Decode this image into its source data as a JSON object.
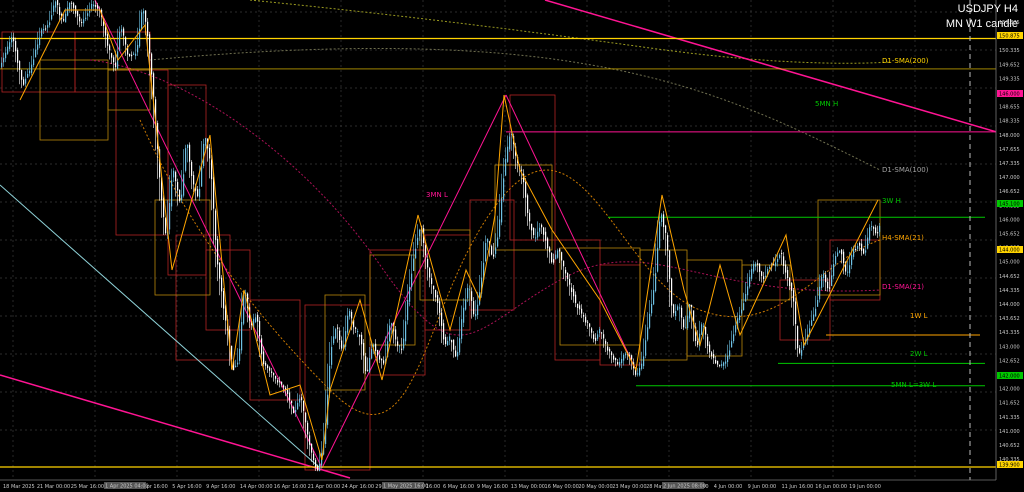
{
  "symbol_title": "USDJPY H4",
  "subtitle": "MN W1 candle",
  "chart_data": {
    "type": "candlestick",
    "title": "USDJPY H4",
    "ylim": [
      140.0,
      151.4
    ],
    "price_ticks": [
      "150.875",
      "150.652",
      "150.335",
      "149.652",
      "149.335",
      "149.000",
      "148.655",
      "148.335",
      "148.000",
      "147.655",
      "147.335",
      "147.000",
      "146.652",
      "146.335",
      "146.000",
      "145.652",
      "145.335",
      "145.000",
      "144.652",
      "144.335",
      "144.000",
      "143.652",
      "143.335",
      "143.000",
      "142.652",
      "142.335",
      "142.000",
      "141.652",
      "141.335",
      "141.000",
      "140.652",
      "140.335"
    ],
    "time_labels": [
      "18 Mar 2025",
      "21 Mar 00:00",
      "25 Mar 16:00",
      "31 Mar 00:00",
      "2 Apr 16:00",
      "5 Apr 16:00",
      "9 Apr 16:00",
      "14 Apr 00:00",
      "16 Apr 16:00",
      "21 Apr 00:00",
      "24 Apr 16:00",
      "29 Apr 00:00",
      "2 May 16:00",
      "6 May 16:00",
      "9 May 16:00",
      "13 May 00:00",
      "16 May 00:00",
      "20 May 00:00",
      "23 May 00:00",
      "28 May 16:00",
      "2 Jun 00:00",
      "4 Jun 00:00",
      "9 Jun 00:00",
      "11 Jun 16:00",
      "16 Jun 00:00",
      "19 Jun 00:00"
    ],
    "highlight_labels": [
      {
        "text": "1 Apr 2025 04:00",
        "value": "highlight-date-1"
      },
      {
        "text": "1 May 2025 16:00",
        "value": "highlight-date-2"
      },
      {
        "text": "2 Jun 2025 08:00",
        "value": "highlight-date-3"
      }
    ],
    "price_path": [
      [
        0,
        149.9
      ],
      [
        12,
        150.6
      ],
      [
        22,
        149.4
      ],
      [
        30,
        149.8
      ],
      [
        40,
        150.7
      ],
      [
        48,
        150.9
      ],
      [
        55,
        151.5
      ],
      [
        62,
        150.9
      ],
      [
        70,
        151.5
      ],
      [
        80,
        150.9
      ],
      [
        92,
        151.4
      ],
      [
        100,
        151.2
      ],
      [
        108,
        150.3
      ],
      [
        115,
        149.8
      ],
      [
        120,
        150.9
      ],
      [
        128,
        150.1
      ],
      [
        136,
        150.2
      ],
      [
        142,
        151.4
      ],
      [
        148,
        150.5
      ],
      [
        154,
        148.8
      ],
      [
        160,
        146.8
      ],
      [
        166,
        145.5
      ],
      [
        172,
        147.4
      ],
      [
        180,
        146.4
      ],
      [
        186,
        148.1
      ],
      [
        192,
        147.0
      ],
      [
        198,
        146.6
      ],
      [
        204,
        148.2
      ],
      [
        210,
        147.5
      ],
      [
        216,
        145.2
      ],
      [
        222,
        144.1
      ],
      [
        228,
        143.2
      ],
      [
        232,
        142.4
      ],
      [
        238,
        142.6
      ],
      [
        244,
        144.5
      ],
      [
        250,
        143.4
      ],
      [
        256,
        143.8
      ],
      [
        262,
        142.6
      ],
      [
        270,
        142.3
      ],
      [
        278,
        142.1
      ],
      [
        286,
        141.9
      ],
      [
        294,
        141.3
      ],
      [
        300,
        141.8
      ],
      [
        306,
        140.9
      ],
      [
        312,
        140.2
      ],
      [
        318,
        139.9
      ],
      [
        324,
        140.7
      ],
      [
        330,
        142.9
      ],
      [
        336,
        143.5
      ],
      [
        342,
        142.8
      ],
      [
        348,
        143.9
      ],
      [
        354,
        143.4
      ],
      [
        360,
        143.2
      ],
      [
        366,
        142.2
      ],
      [
        372,
        143.1
      ],
      [
        378,
        142.7
      ],
      [
        384,
        142.5
      ],
      [
        390,
        143.7
      ],
      [
        396,
        143.0
      ],
      [
        402,
        142.9
      ],
      [
        408,
        144.3
      ],
      [
        414,
        145.3
      ],
      [
        420,
        146.0
      ],
      [
        426,
        145.0
      ],
      [
        432,
        144.4
      ],
      [
        438,
        144.0
      ],
      [
        444,
        143.0
      ],
      [
        450,
        143.2
      ],
      [
        456,
        142.6
      ],
      [
        462,
        143.8
      ],
      [
        468,
        144.5
      ],
      [
        474,
        143.6
      ],
      [
        480,
        144.4
      ],
      [
        486,
        145.7
      ],
      [
        492,
        145.1
      ],
      [
        498,
        145.8
      ],
      [
        504,
        147.4
      ],
      [
        510,
        148.3
      ],
      [
        516,
        147.5
      ],
      [
        522,
        147.2
      ],
      [
        528,
        146.1
      ],
      [
        534,
        145.6
      ],
      [
        540,
        146.0
      ],
      [
        546,
        145.5
      ],
      [
        552,
        145.0
      ],
      [
        558,
        145.4
      ],
      [
        564,
        144.8
      ],
      [
        570,
        144.4
      ],
      [
        576,
        144.0
      ],
      [
        582,
        143.7
      ],
      [
        588,
        143.5
      ],
      [
        594,
        143.1
      ],
      [
        600,
        143.4
      ],
      [
        606,
        142.9
      ],
      [
        612,
        142.7
      ],
      [
        618,
        142.5
      ],
      [
        624,
        142.8
      ],
      [
        630,
        142.7
      ],
      [
        636,
        142.2
      ],
      [
        642,
        142.6
      ],
      [
        648,
        143.6
      ],
      [
        654,
        144.5
      ],
      [
        660,
        146.3
      ],
      [
        666,
        145.6
      ],
      [
        672,
        143.7
      ],
      [
        678,
        144.0
      ],
      [
        684,
        143.3
      ],
      [
        690,
        144.1
      ],
      [
        696,
        142.9
      ],
      [
        702,
        143.6
      ],
      [
        708,
        142.9
      ],
      [
        714,
        142.6
      ],
      [
        720,
        142.5
      ],
      [
        726,
        142.6
      ],
      [
        732,
        143.2
      ],
      [
        738,
        143.7
      ],
      [
        744,
        144.1
      ],
      [
        750,
        144.8
      ],
      [
        756,
        145.1
      ],
      [
        762,
        144.6
      ],
      [
        768,
        144.9
      ],
      [
        774,
        145.0
      ],
      [
        780,
        145.3
      ],
      [
        786,
        144.7
      ],
      [
        792,
        144.3
      ],
      [
        798,
        142.7
      ],
      [
        804,
        143.1
      ],
      [
        810,
        143.5
      ],
      [
        816,
        144.0
      ],
      [
        822,
        144.8
      ],
      [
        828,
        144.3
      ],
      [
        834,
        145.1
      ],
      [
        840,
        145.4
      ],
      [
        846,
        144.7
      ],
      [
        852,
        145.3
      ],
      [
        858,
        145.5
      ],
      [
        864,
        145.2
      ],
      [
        870,
        146.0
      ],
      [
        876,
        145.7
      ],
      [
        880,
        146.0
      ]
    ],
    "horizontal_levels": [
      {
        "name": "top-line-yellow",
        "price": 150.55,
        "color": "#ffd400"
      },
      {
        "name": "level-149-8",
        "price": 149.8,
        "color": "#ffd400"
      },
      {
        "name": "level-5mn-h",
        "price": 148.25,
        "color": "#ff1493"
      },
      {
        "name": "level-3w-h",
        "price": 146.15,
        "color": "#00c800"
      },
      {
        "name": "level-1w-l",
        "price": 143.25,
        "color": "#ffa500"
      },
      {
        "name": "level-2w-l",
        "price": 142.55,
        "color": "#00c800"
      },
      {
        "name": "level-5mn-l-3w-l",
        "price": 142.0,
        "color": "#00c800"
      },
      {
        "name": "bottom-line-yellow",
        "price": 140.0,
        "color": "#ffd400"
      }
    ],
    "annotations": [
      {
        "text": "D1-SMA(200)",
        "color": "#ffd400"
      },
      {
        "text": "5MN H",
        "color": "#00c800"
      },
      {
        "text": "D1-SMA(100)",
        "color": "#a0a0a0"
      },
      {
        "text": "3MN L",
        "color": "#ff1493"
      },
      {
        "text": "3W H",
        "color": "#00c800"
      },
      {
        "text": "H4-SMA(21)",
        "color": "#ffa500"
      },
      {
        "text": "D1-SMA(21)",
        "color": "#ff1493"
      },
      {
        "text": "1W L",
        "color": "#ffa500"
      },
      {
        "text": "2W L",
        "color": "#00c800"
      },
      {
        "text": "5MN L=3W L",
        "color": "#00c800"
      }
    ],
    "grid": true,
    "colors": {
      "background": "#000000",
      "bull_candle": "#6ec1e4",
      "bear_candle": "#ffffff",
      "zigzag": "#ffa500",
      "trendline_pink": "#ff1493",
      "trendline_cyan": "#8fd3d9"
    }
  }
}
